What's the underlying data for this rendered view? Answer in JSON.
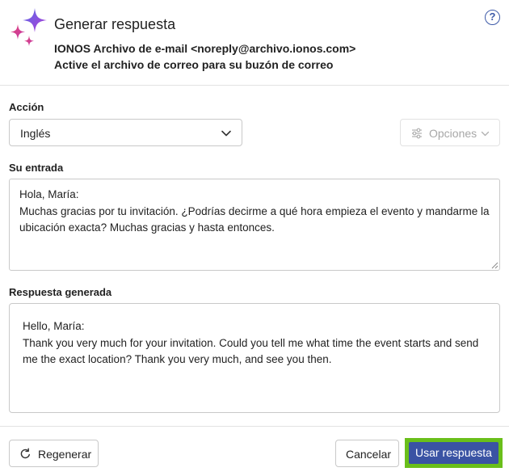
{
  "header": {
    "title": "Generar respuesta",
    "sender": "IONOS Archivo de e-mail <noreply@archivo.ionos.com>",
    "subject": "Active el archivo de correo para su buzón de correo",
    "logo_icon": "sparkles-icon",
    "help_icon": "help-icon",
    "help_glyph": "?"
  },
  "accion": {
    "label": "Acción",
    "selected": "Inglés",
    "chevron_icon": "chevron-down-icon"
  },
  "opciones": {
    "label": "Opciones",
    "icon": "sliders-icon",
    "enabled": false
  },
  "input": {
    "label": "Su entrada",
    "line1": "Hola, María:",
    "line2": "Muchas gracias por tu invitación. ¿Podrías decirme a qué hora empieza el evento y mandarme la ubicación exacta? Muchas gracias y hasta entonces."
  },
  "output": {
    "label": "Respuesta generada",
    "line1": "Hello, María:",
    "line2": "Thank you very much for your invitation. Could you tell me what time the event starts and send me the exact location? Thank you very much, and see you then."
  },
  "footer": {
    "regenerate_label": "Regenerar",
    "cancel_label": "Cancelar",
    "use_label": "Usar respuesta"
  },
  "colors": {
    "primary": "#3a53a4",
    "highlight": "#6abf1a",
    "logo_purple": "#7b4fd9",
    "logo_pink": "#e0457b"
  }
}
